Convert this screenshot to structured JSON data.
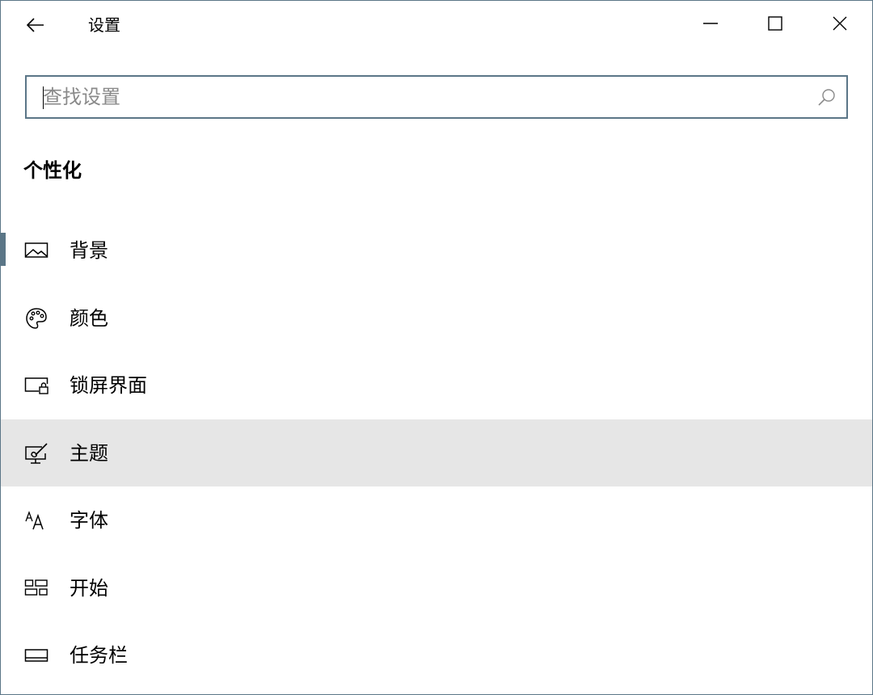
{
  "window": {
    "title": "设置"
  },
  "search": {
    "placeholder": "查找设置",
    "value": ""
  },
  "section": {
    "title": "个性化"
  },
  "nav": {
    "items": [
      {
        "label": "背景",
        "icon": "picture-icon",
        "selected": true
      },
      {
        "label": "颜色",
        "icon": "palette-icon"
      },
      {
        "label": "锁屏界面",
        "icon": "lock-screen-icon"
      },
      {
        "label": "主题",
        "icon": "theme-brush-icon",
        "hover": true
      },
      {
        "label": "字体",
        "icon": "font-icon"
      },
      {
        "label": "开始",
        "icon": "start-tiles-icon"
      },
      {
        "label": "任务栏",
        "icon": "taskbar-icon"
      }
    ]
  },
  "colors": {
    "accent": "#5b7687",
    "hover_bg": "#e6e6e6"
  }
}
